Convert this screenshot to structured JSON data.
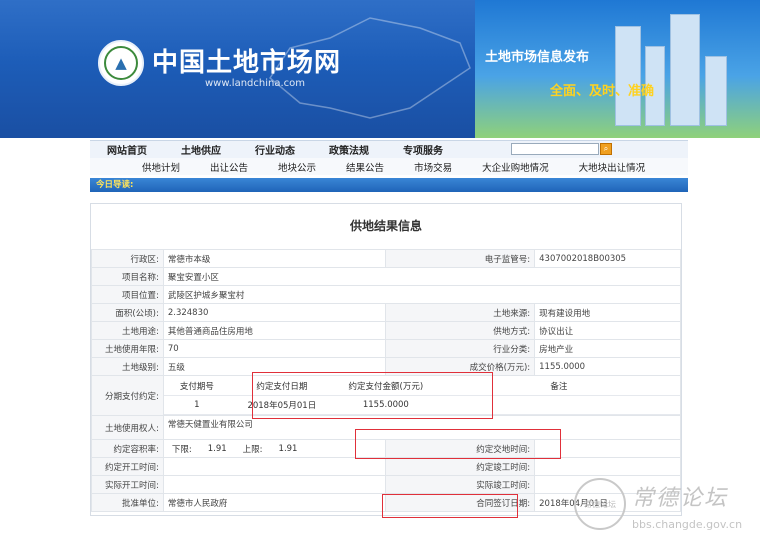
{
  "site": {
    "title": "中国土地市场网",
    "url": "www.landchina.com",
    "banner_title": "土地市场信息发布",
    "banner_slogan": "全面、及时、准确"
  },
  "nav": {
    "main": [
      "网站首页",
      "土地供应",
      "行业动态",
      "政策法规",
      "专项服务"
    ],
    "sub": [
      "供地计划",
      "出让公告",
      "地块公示",
      "结果公告",
      "市场交易",
      "大企业购地情况",
      "大地块出让情况"
    ],
    "search_placeholder": ""
  },
  "guide": {
    "label": "今日导读:"
  },
  "page": {
    "heading": "供地结果信息"
  },
  "fields": {
    "district_label": "行政区:",
    "district": "常德市本级",
    "supervision_label": "电子监管号:",
    "supervision": "4307002018B00305",
    "project_name_label": "项目名称:",
    "project_name": "聚宝安置小区",
    "location_label": "项目位置:",
    "location": "武陵区护城乡聚宝村",
    "area_label": "面积(公顷):",
    "area": "2.324830",
    "source_label": "土地来源:",
    "source": "现有建设用地",
    "usage_label": "土地用途:",
    "usage": "其他普通商品住房用地",
    "supply_method_label": "供地方式:",
    "supply_method": "协议出让",
    "years_label": "土地使用年限:",
    "years": "70",
    "industry_label": "行业分类:",
    "industry": "房地产业",
    "grade_label": "土地级别:",
    "grade": "五级",
    "price_label": "成交价格(万元):",
    "price": "1155.0000",
    "installment_label": "分期支付约定:",
    "pay_headers": [
      "支付期号",
      "约定支付日期",
      "约定支付金额(万元)",
      "备注"
    ],
    "pay_row": [
      "1",
      "2018年05月01日",
      "1155.0000",
      ""
    ],
    "user_label": "土地使用权人:",
    "user": "常德天健置业有限公司",
    "plot_ratio_label": "约定容积率:",
    "lower_label": "下限:",
    "lower": "1.91",
    "upper_label": "上限:",
    "upper": "1.91",
    "delivery_label": "约定交地时间:",
    "delivery": "",
    "start_label": "约定开工时间:",
    "start": "",
    "finish_label": "约定竣工时间:",
    "finish": "",
    "actual_start_label": "实际开工时间:",
    "actual_start": "",
    "actual_finish_label": "实际竣工时间:",
    "actual_finish": "",
    "approver_label": "批准单位:",
    "approver": "常德市人民政府",
    "contract_label": "合同签订日期:",
    "contract": "2018年04月01日"
  },
  "watermark": {
    "circle": "常德论坛",
    "name": "常德论坛",
    "url": "bbs.changde.gov.cn"
  },
  "colors": {
    "header_blue": "#1d5db8",
    "highlight_red": "#e0303a",
    "slogan_yellow": "#ffd21f"
  }
}
